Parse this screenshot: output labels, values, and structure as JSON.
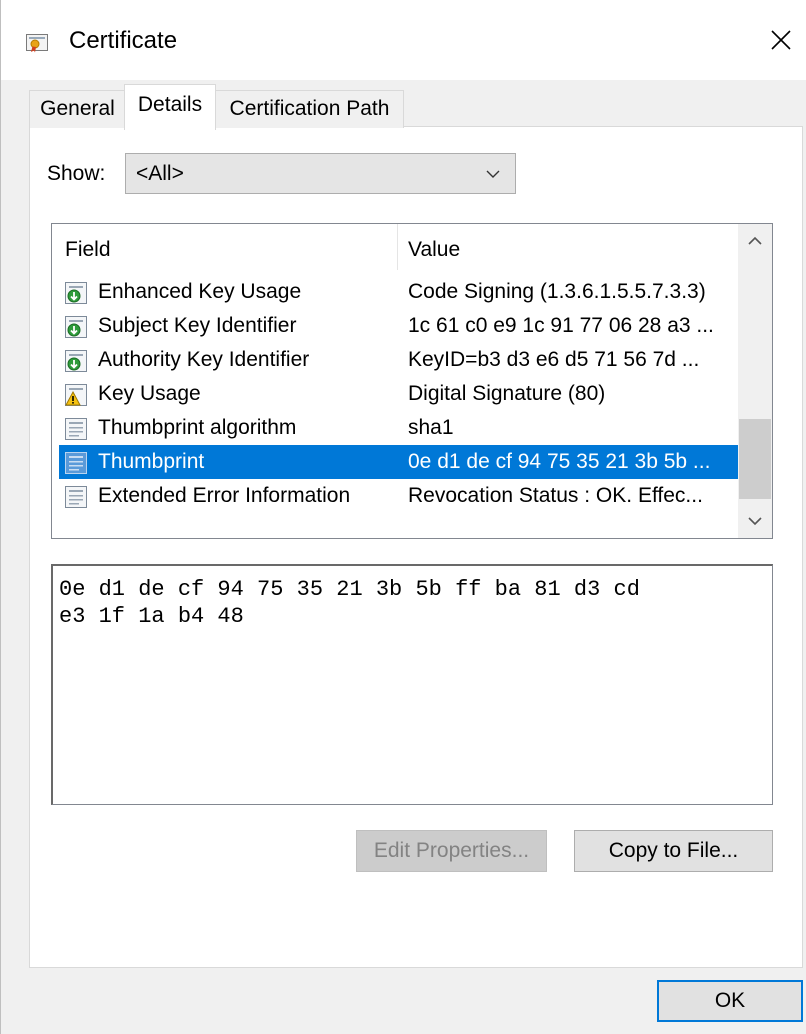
{
  "window": {
    "title": "Certificate",
    "close_glyph": "✕"
  },
  "tabs": [
    {
      "label": "General",
      "active": false
    },
    {
      "label": "Details",
      "active": true
    },
    {
      "label": "Certification Path",
      "active": false
    }
  ],
  "show": {
    "label": "Show:",
    "selected": "<All>"
  },
  "list": {
    "columns": {
      "field": "Field",
      "value": "Value"
    },
    "rows": [
      {
        "field": "Enhanced Key Usage",
        "value": "Code Signing (1.3.6.1.5.5.7.3.3)",
        "icon": "extension-icon"
      },
      {
        "field": "Subject Key Identifier",
        "value": "1c 61 c0 e9 1c 91 77 06 28 a3 ...",
        "icon": "extension-icon"
      },
      {
        "field": "Authority Key Identifier",
        "value": "KeyID=b3 d3 e6 d5 71 56 7d ...",
        "icon": "extension-icon"
      },
      {
        "field": "Key Usage",
        "value": "Digital Signature (80)",
        "icon": "critical-extension-icon"
      },
      {
        "field": "Thumbprint algorithm",
        "value": "sha1",
        "icon": "property-icon"
      },
      {
        "field": "Thumbprint",
        "value": "0e d1 de cf 94 75 35 21 3b 5b ...",
        "icon": "property-icon",
        "selected": true
      },
      {
        "field": "Extended Error Information",
        "value": "Revocation Status : OK. Effec...",
        "icon": "property-icon"
      }
    ]
  },
  "detail": {
    "text": "0e d1 de cf 94 75 35 21 3b 5b ff ba 81 d3 cd\ne3 1f 1a b4 48"
  },
  "buttons": {
    "edit_properties": "Edit Properties...",
    "copy_to_file": "Copy to File...",
    "ok": "OK"
  },
  "colors": {
    "selection": "#0078d7",
    "default_button_border": "#0078d7"
  }
}
